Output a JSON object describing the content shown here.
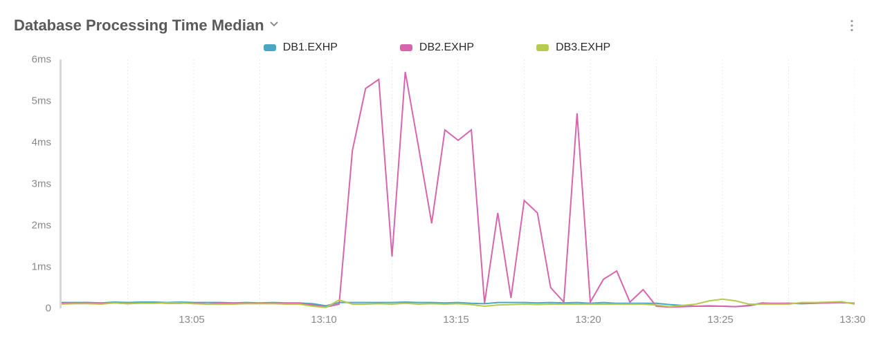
{
  "title": "Database Processing Time Median",
  "colors": {
    "db1": "#4aa7c4",
    "db2": "#d864ad",
    "db3": "#b4cc4a"
  },
  "legend": [
    {
      "key": "db1",
      "label": "DB1.EXHP"
    },
    {
      "key": "db2",
      "label": "DB2.EXHP"
    },
    {
      "key": "db3",
      "label": "DB3.EXHP"
    }
  ],
  "chart_data": {
    "type": "line",
    "title": "Database Processing Time Median",
    "xlabel": "",
    "ylabel": "",
    "ylim": [
      0,
      6
    ],
    "y_unit": "ms",
    "y_ticks": [
      0,
      1,
      2,
      3,
      4,
      5,
      6
    ],
    "y_tick_labels": [
      "0",
      "1ms",
      "2ms",
      "3ms",
      "4ms",
      "5ms",
      "6ms"
    ],
    "x_range_minutes": [
      0,
      30
    ],
    "x_ticks_minutes": [
      5,
      10,
      15,
      20,
      25,
      30
    ],
    "x_tick_labels": [
      "13:05",
      "13:10",
      "13:15",
      "13:20",
      "13:25",
      "13:30"
    ],
    "x_grid_minutes": [
      2.5,
      5,
      7.5,
      10,
      12.5,
      15,
      17.5,
      20,
      22.5,
      25,
      27.5,
      30
    ],
    "series": [
      {
        "name": "DB1.EXHP",
        "color_key": "db1",
        "points": [
          [
            0,
            0.14
          ],
          [
            0.5,
            0.14
          ],
          [
            1,
            0.14
          ],
          [
            1.5,
            0.13
          ],
          [
            2,
            0.15
          ],
          [
            2.5,
            0.14
          ],
          [
            3,
            0.15
          ],
          [
            3.5,
            0.15
          ],
          [
            4,
            0.14
          ],
          [
            4.5,
            0.15
          ],
          [
            5,
            0.14
          ],
          [
            5.5,
            0.14
          ],
          [
            6,
            0.14
          ],
          [
            6.5,
            0.13
          ],
          [
            7,
            0.14
          ],
          [
            7.5,
            0.13
          ],
          [
            8,
            0.14
          ],
          [
            8.5,
            0.13
          ],
          [
            9,
            0.13
          ],
          [
            9.5,
            0.11
          ],
          [
            10,
            0.06
          ],
          [
            10.5,
            0.14
          ],
          [
            11,
            0.14
          ],
          [
            11.5,
            0.14
          ],
          [
            12,
            0.14
          ],
          [
            12.5,
            0.14
          ],
          [
            13,
            0.15
          ],
          [
            13.5,
            0.14
          ],
          [
            14,
            0.14
          ],
          [
            14.5,
            0.13
          ],
          [
            15,
            0.14
          ],
          [
            15.5,
            0.12
          ],
          [
            16,
            0.11
          ],
          [
            16.5,
            0.14
          ],
          [
            17,
            0.14
          ],
          [
            17.5,
            0.14
          ],
          [
            18,
            0.13
          ],
          [
            18.5,
            0.14
          ],
          [
            19,
            0.13
          ],
          [
            19.5,
            0.14
          ],
          [
            20,
            0.12
          ],
          [
            20.5,
            0.14
          ],
          [
            21,
            0.12
          ],
          [
            21.5,
            0.12
          ],
          [
            22,
            0.12
          ],
          [
            22.5,
            0.12
          ],
          [
            23,
            0.09
          ],
          [
            24,
            0.05
          ],
          [
            24.5,
            0.06
          ],
          [
            25,
            0.05
          ],
          [
            25.5,
            0.04
          ],
          [
            26,
            0.07
          ],
          [
            26.5,
            0.13
          ],
          [
            27,
            0.11
          ],
          [
            27.5,
            0.12
          ],
          [
            28,
            0.11
          ],
          [
            28.5,
            0.12
          ],
          [
            29,
            0.14
          ],
          [
            29.5,
            0.14
          ],
          [
            30,
            0.12
          ]
        ]
      },
      {
        "name": "DB2.EXHP",
        "color_key": "db2",
        "points": [
          [
            0,
            0.12
          ],
          [
            0.5,
            0.12
          ],
          [
            1,
            0.14
          ],
          [
            1.5,
            0.12
          ],
          [
            2,
            0.13
          ],
          [
            2.5,
            0.11
          ],
          [
            3,
            0.13
          ],
          [
            3.5,
            0.13
          ],
          [
            4,
            0.12
          ],
          [
            4.5,
            0.12
          ],
          [
            5,
            0.13
          ],
          [
            5.5,
            0.1
          ],
          [
            6,
            0.12
          ],
          [
            6.5,
            0.12
          ],
          [
            7,
            0.13
          ],
          [
            7.5,
            0.12
          ],
          [
            8,
            0.13
          ],
          [
            8.5,
            0.12
          ],
          [
            9,
            0.12
          ],
          [
            9.5,
            0.08
          ],
          [
            10,
            0.03
          ],
          [
            10.5,
            0.1
          ],
          [
            11,
            3.8
          ],
          [
            11.5,
            5.3
          ],
          [
            12,
            5.52
          ],
          [
            12.5,
            1.25
          ],
          [
            13,
            5.7
          ],
          [
            13.5,
            3.9
          ],
          [
            14,
            2.05
          ],
          [
            14.5,
            4.3
          ],
          [
            15,
            4.05
          ],
          [
            15.5,
            4.3
          ],
          [
            16,
            0.12
          ],
          [
            16.5,
            2.3
          ],
          [
            17,
            0.25
          ],
          [
            17.5,
            2.6
          ],
          [
            18,
            2.3
          ],
          [
            18.5,
            0.5
          ],
          [
            19,
            0.15
          ],
          [
            19.5,
            4.7
          ],
          [
            20,
            0.15
          ],
          [
            20.5,
            0.7
          ],
          [
            21,
            0.9
          ],
          [
            21.5,
            0.15
          ],
          [
            22,
            0.45
          ],
          [
            22.5,
            0.05
          ],
          [
            23,
            0.03
          ],
          [
            24,
            0.05
          ],
          [
            24.5,
            0.05
          ],
          [
            25,
            0.05
          ],
          [
            25.5,
            0.04
          ],
          [
            26,
            0.06
          ],
          [
            26.5,
            0.12
          ],
          [
            27,
            0.12
          ],
          [
            27.5,
            0.12
          ],
          [
            28,
            0.12
          ],
          [
            28.5,
            0.12
          ],
          [
            29,
            0.13
          ],
          [
            29.5,
            0.14
          ],
          [
            30,
            0.12
          ]
        ]
      },
      {
        "name": "DB3.EXHP",
        "color_key": "db3",
        "points": [
          [
            0,
            0.1
          ],
          [
            0.5,
            0.11
          ],
          [
            1,
            0.11
          ],
          [
            1.5,
            0.1
          ],
          [
            2,
            0.13
          ],
          [
            2.5,
            0.11
          ],
          [
            3,
            0.12
          ],
          [
            3.5,
            0.12
          ],
          [
            4,
            0.13
          ],
          [
            4.5,
            0.13
          ],
          [
            5,
            0.11
          ],
          [
            5.5,
            0.1
          ],
          [
            6,
            0.1
          ],
          [
            6.5,
            0.1
          ],
          [
            7,
            0.11
          ],
          [
            7.5,
            0.11
          ],
          [
            8,
            0.11
          ],
          [
            8.5,
            0.1
          ],
          [
            9,
            0.1
          ],
          [
            9.5,
            0.05
          ],
          [
            10,
            0.02
          ],
          [
            10.5,
            0.2
          ],
          [
            11,
            0.1
          ],
          [
            11.5,
            0.1
          ],
          [
            12,
            0.11
          ],
          [
            12.5,
            0.1
          ],
          [
            13,
            0.12
          ],
          [
            13.5,
            0.1
          ],
          [
            14,
            0.11
          ],
          [
            14.5,
            0.1
          ],
          [
            15,
            0.11
          ],
          [
            15.5,
            0.09
          ],
          [
            16,
            0.05
          ],
          [
            16.5,
            0.08
          ],
          [
            17,
            0.09
          ],
          [
            17.5,
            0.1
          ],
          [
            18,
            0.09
          ],
          [
            18.5,
            0.1
          ],
          [
            19,
            0.1
          ],
          [
            19.5,
            0.1
          ],
          [
            20,
            0.1
          ],
          [
            20.5,
            0.1
          ],
          [
            21,
            0.1
          ],
          [
            21.5,
            0.1
          ],
          [
            22,
            0.1
          ],
          [
            22.5,
            0.08
          ],
          [
            23,
            0.04
          ],
          [
            24,
            0.1
          ],
          [
            24.5,
            0.18
          ],
          [
            25,
            0.22
          ],
          [
            25.5,
            0.18
          ],
          [
            26,
            0.1
          ],
          [
            26.5,
            0.1
          ],
          [
            27,
            0.1
          ],
          [
            27.5,
            0.1
          ],
          [
            28,
            0.14
          ],
          [
            28.5,
            0.14
          ],
          [
            29,
            0.15
          ],
          [
            29.5,
            0.16
          ],
          [
            30,
            0.1
          ]
        ]
      }
    ]
  }
}
